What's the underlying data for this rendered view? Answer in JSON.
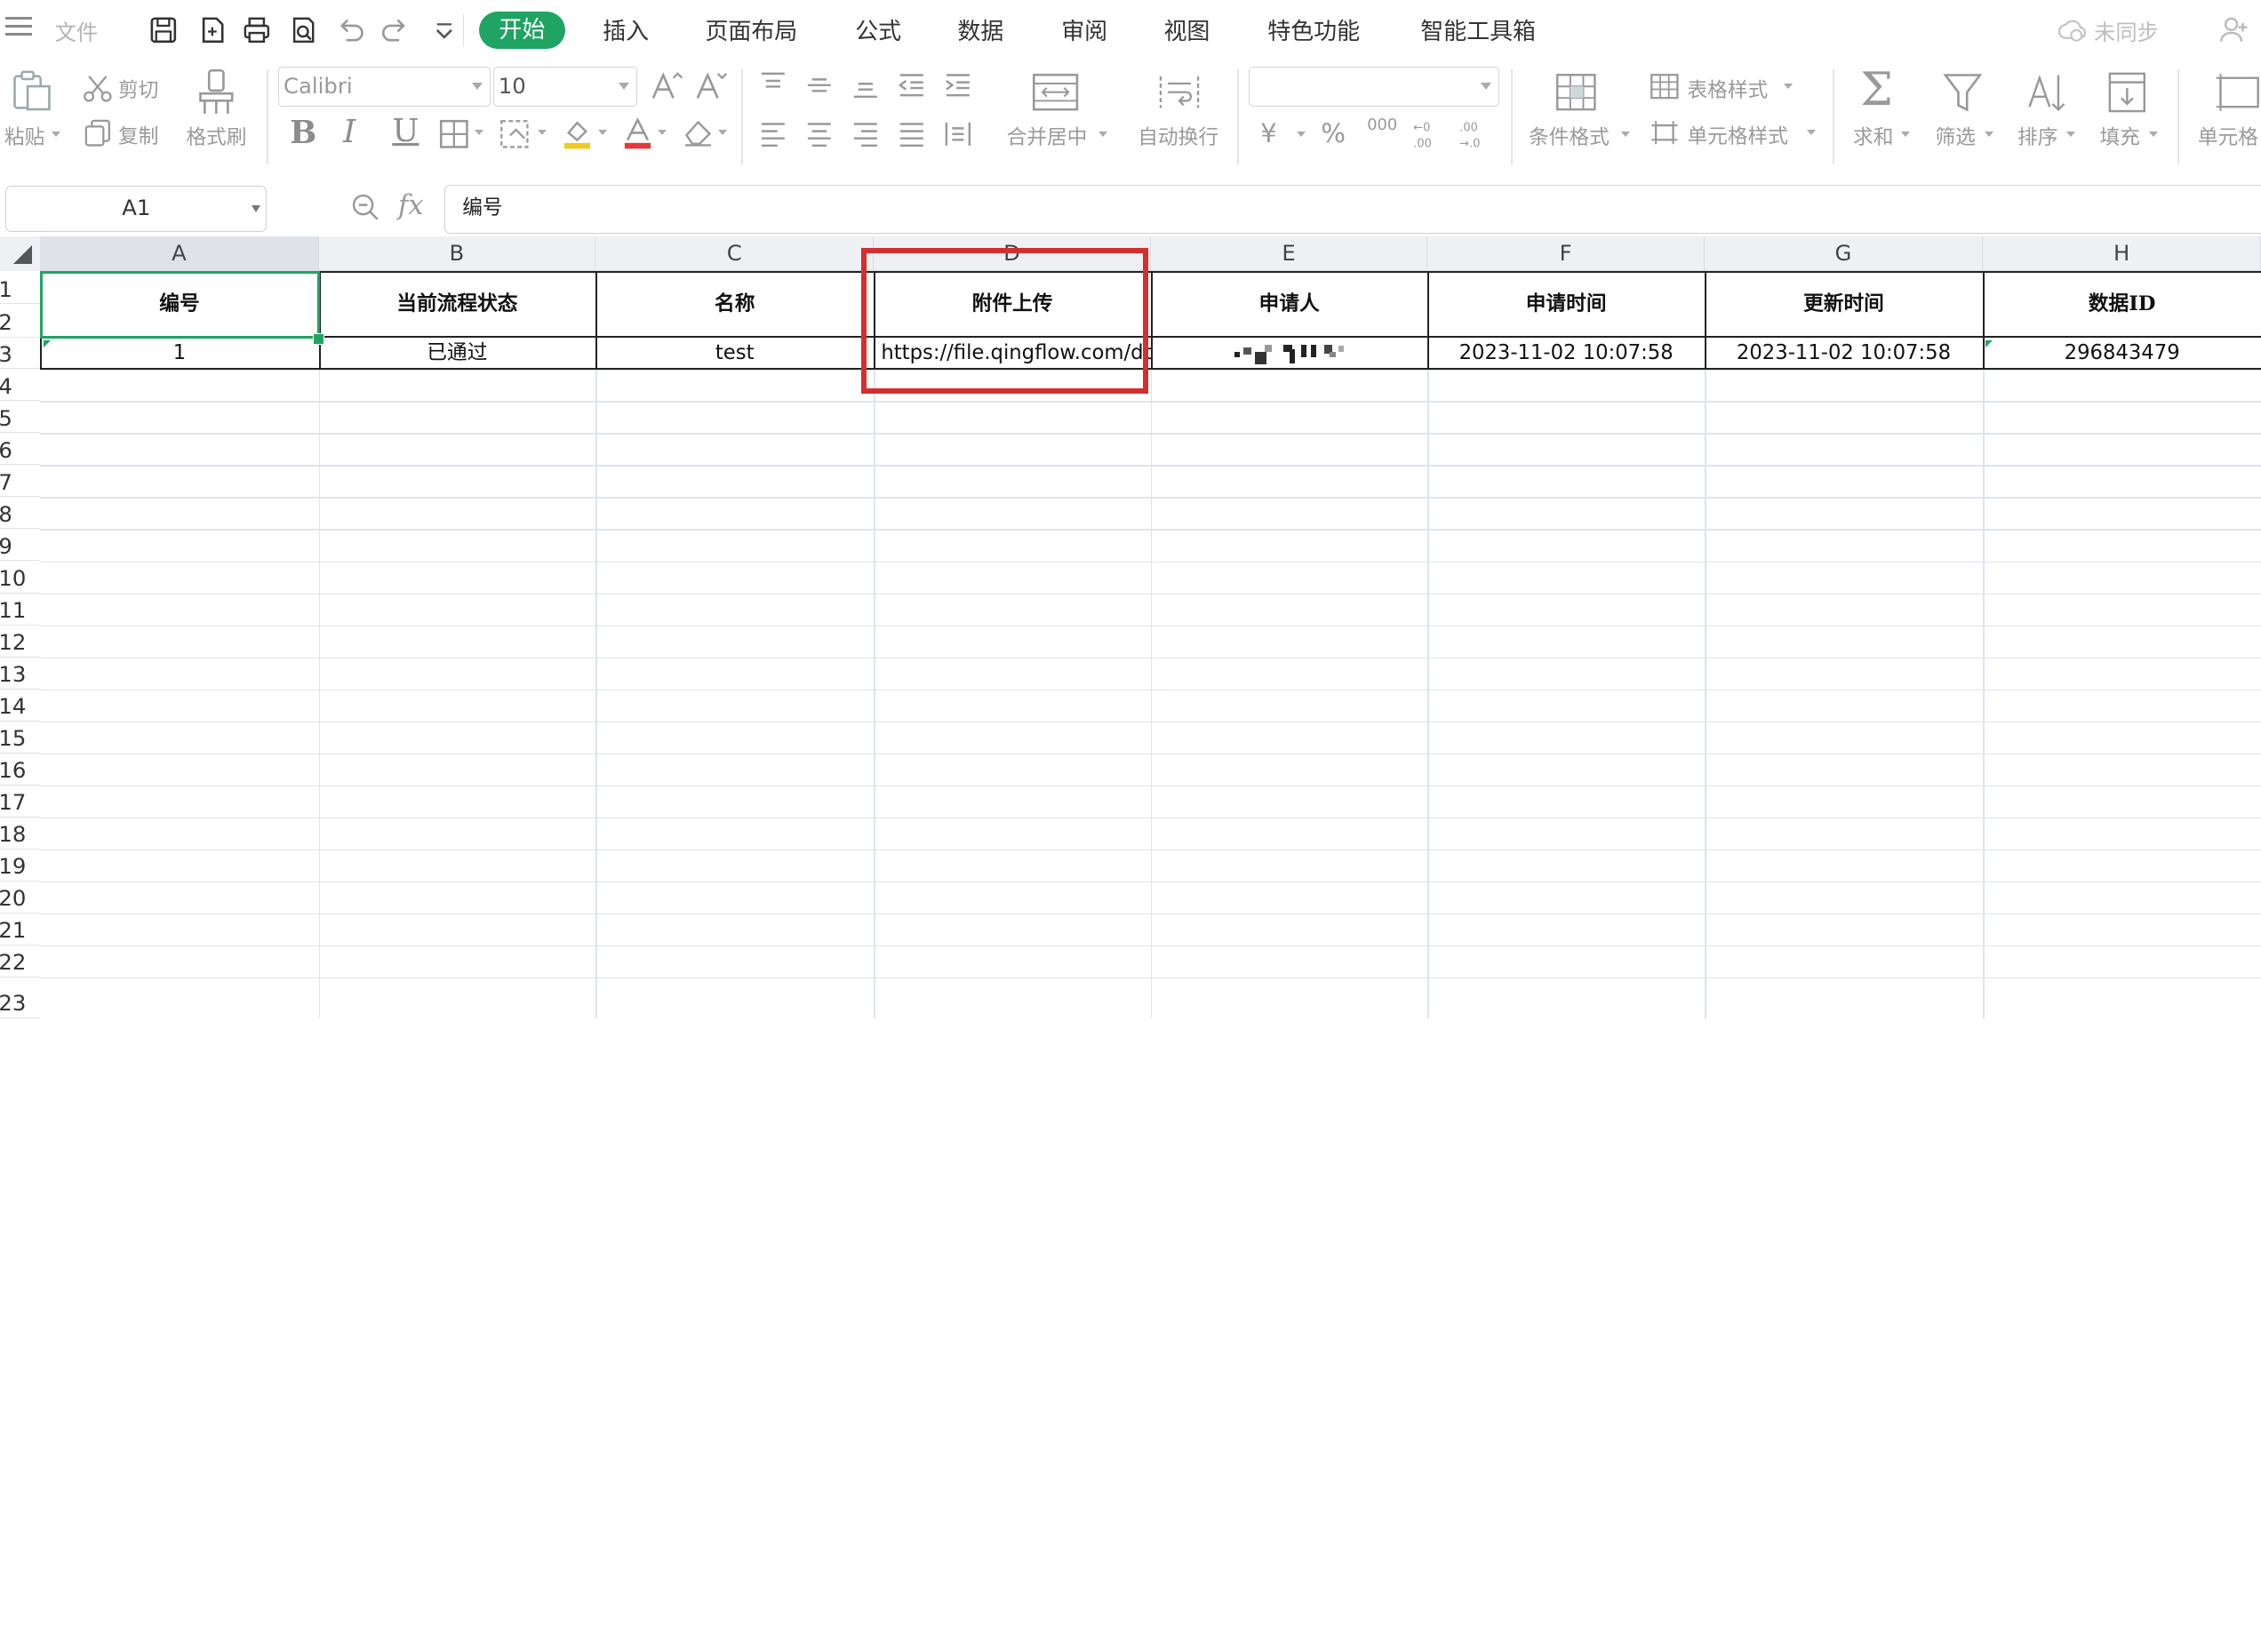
{
  "menu": {
    "file": "文件",
    "tabs": [
      "开始",
      "插入",
      "页面布局",
      "公式",
      "数据",
      "审阅",
      "视图",
      "特色功能",
      "智能工具箱"
    ],
    "active_tab": "开始",
    "sync_status": "未同步"
  },
  "ribbon": {
    "cut": "剪切",
    "paste": "粘贴",
    "copy": "复制",
    "format_painter": "格式刷",
    "font_name": "Calibri",
    "font_size": "10",
    "merge_center": "合并居中",
    "wrap_text": "自动换行",
    "currency_symbol": "¥",
    "percent_symbol": "%",
    "thousands": "000",
    "conditional_format": "条件格式",
    "table_style": "表格样式",
    "cell_style": "单元格样式",
    "sum": "求和",
    "filter": "筛选",
    "sort": "排序",
    "fill": "填充",
    "cell": "单元格"
  },
  "formula_bar": {
    "name_box": "A1",
    "fx_label": "fx",
    "content": "编号"
  },
  "columns": [
    "A",
    "B",
    "C",
    "D",
    "E",
    "F",
    "G",
    "H"
  ],
  "rows": [
    "1",
    "2",
    "3",
    "4",
    "5",
    "6",
    "7",
    "8",
    "9",
    "10",
    "11",
    "12",
    "13",
    "14",
    "15",
    "16",
    "17",
    "18",
    "19",
    "20",
    "21",
    "22",
    "23"
  ],
  "header_row": [
    "编号",
    "当前流程状态",
    "名称",
    "附件上传",
    "申请人",
    "申请时间",
    "更新时间",
    "数据ID"
  ],
  "data_row": [
    "1",
    "已通过",
    "test",
    "https://file.qingflow.com/dc",
    "",
    "2023-11-02 10:07:58",
    "2023-11-02 10:07:58",
    "296843479"
  ],
  "colors": {
    "accent_green": "#1fa463",
    "highlight_red": "#d32f2f"
  }
}
